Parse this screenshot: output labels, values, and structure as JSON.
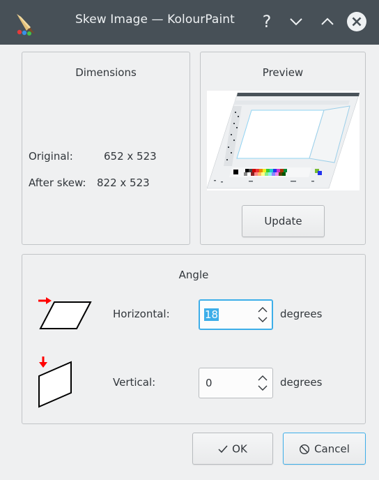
{
  "window": {
    "title": "Skew Image — KolourPaint",
    "help_glyph": "?"
  },
  "dimensions": {
    "title": "Dimensions",
    "original_label": "Original:",
    "original_value": "652 x 523",
    "after_label": "After skew:",
    "after_value": "822 x 523"
  },
  "preview": {
    "title": "Preview",
    "update_label": "Update"
  },
  "angle": {
    "title": "Angle",
    "horizontal_label": "Horizontal:",
    "horizontal_value": "18",
    "horizontal_unit": "degrees",
    "vertical_label": "Vertical:",
    "vertical_value": "0",
    "vertical_unit": "degrees"
  },
  "buttons": {
    "ok_label": "OK",
    "cancel_label": "Cancel"
  },
  "colors": {
    "titlebar": "#475057",
    "accent": "#3daee9",
    "arrow_red": "#ff0000"
  }
}
